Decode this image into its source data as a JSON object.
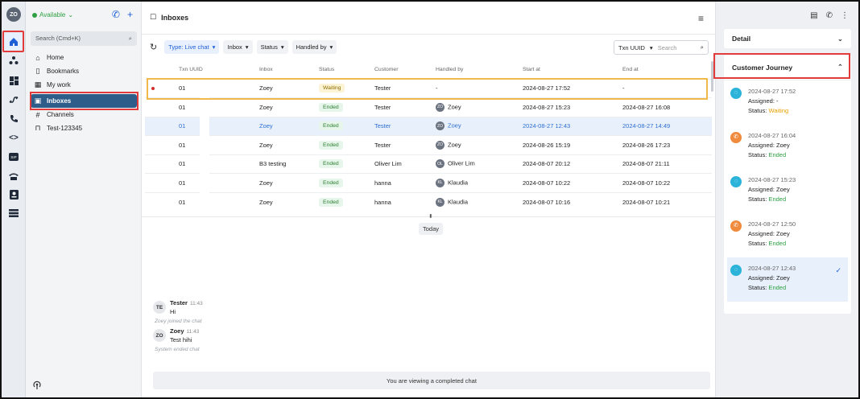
{
  "user": {
    "initials": "ZO",
    "status": "Available"
  },
  "sidebar": {
    "search_placeholder": "Search (Cmd+K)",
    "items": [
      {
        "label": "Home",
        "icon": "home-icon"
      },
      {
        "label": "Bookmarks",
        "icon": "bookmark-icon"
      },
      {
        "label": "My work",
        "icon": "calendar-icon"
      },
      {
        "label": "Inboxes",
        "icon": "inbox-icon",
        "active": true
      },
      {
        "label": "Channels",
        "icon": "hash-icon"
      },
      {
        "label": "Test-123345",
        "icon": "lock-icon"
      }
    ]
  },
  "main": {
    "title": "Inboxes",
    "filters": {
      "type": "Type: Live chat",
      "inbox": "Inbox",
      "status": "Status",
      "handled_by": "Handled by"
    },
    "search": {
      "field": "Txn UUID",
      "placeholder": "Search"
    },
    "columns": [
      "Txn UUID",
      "Inbox",
      "Status",
      "Customer",
      "Handled by",
      "Start at",
      "End at"
    ],
    "rows": [
      {
        "uuid": "01",
        "inbox": "Zoey",
        "status": "Waiting",
        "customer": "Tester",
        "handler": "-",
        "handler_initials": "",
        "start": "2024-08-27 17:52",
        "end": "-"
      },
      {
        "uuid": "01",
        "inbox": "Zoey",
        "status": "Ended",
        "customer": "Tester",
        "handler": "Zoey",
        "handler_initials": "ZO",
        "start": "2024-08-27 15:23",
        "end": "2024-08-27 16:08"
      },
      {
        "uuid": "01",
        "inbox": "Zoey",
        "status": "Ended",
        "customer": "Tester",
        "handler": "Zoey",
        "handler_initials": "ZO",
        "start": "2024-08-27 12:43",
        "end": "2024-08-27 14:49"
      },
      {
        "uuid": "01",
        "inbox": "Zoey",
        "status": "Ended",
        "customer": "Tester",
        "handler": "Zoey",
        "handler_initials": "ZO",
        "start": "2024-08-26 15:19",
        "end": "2024-08-26 17:23"
      },
      {
        "uuid": "01",
        "inbox": "B3 testing",
        "status": "Ended",
        "customer": "Oliver Lim",
        "handler": "Oliver Lim",
        "handler_initials": "OL",
        "start": "2024-08-07 20:12",
        "end": "2024-08-07 21:11"
      },
      {
        "uuid": "01",
        "inbox": "Zoey",
        "status": "Ended",
        "customer": "hanna",
        "handler": "Klaudia",
        "handler_initials": "KL",
        "start": "2024-08-07 10:22",
        "end": "2024-08-07 10:22"
      },
      {
        "uuid": "01",
        "inbox": "Zoey",
        "status": "Ended",
        "customer": "hanna",
        "handler": "Klaudia",
        "handler_initials": "KL",
        "start": "2024-08-07 10:16",
        "end": "2024-08-07 10:21"
      }
    ],
    "today_label": "Today",
    "chat": {
      "messages": [
        {
          "initials": "TE",
          "name": "Tester",
          "time": "11:43",
          "text": "Hi"
        },
        {
          "initials": "ZO",
          "name": "Zoey",
          "time": "11:43",
          "text": "Test hihi"
        }
      ],
      "joined": "Zoey joined the chat",
      "ended": "System ended chat"
    },
    "footer": "You are viewing a completed chat"
  },
  "right": {
    "detail_label": "Detail",
    "journey_label": "Customer Journey",
    "journey": [
      {
        "date": "2024-08-27 17:52",
        "assigned": "Assigned: -",
        "status_prefix": "Status: ",
        "status": "Waiting",
        "color": "#2bb3d9"
      },
      {
        "date": "2024-08-27 16:04",
        "assigned": "Assigned: Zoey",
        "status_prefix": "Status: ",
        "status": "Ended",
        "color": "#f08a3c"
      },
      {
        "date": "2024-08-27 15:23",
        "assigned": "Assigned: Zoey",
        "status_prefix": "Status: ",
        "status": "Ended",
        "color": "#2bb3d9"
      },
      {
        "date": "2024-08-27 12:50",
        "assigned": "Assigned: Zoey",
        "status_prefix": "Status: ",
        "status": "Ended",
        "color": "#f08a3c"
      },
      {
        "date": "2024-08-27 12:43",
        "assigned": "Assigned: Zoey",
        "status_prefix": "Status: ",
        "status": "Ended",
        "color": "#2bb3d9",
        "selected": true
      }
    ]
  }
}
